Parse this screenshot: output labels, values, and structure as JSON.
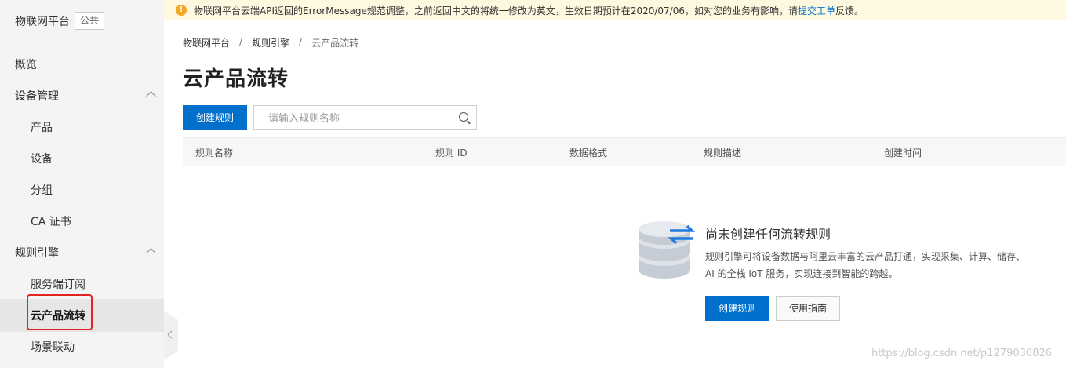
{
  "notice": {
    "text_before": "物联网平台云端API返回的ErrorMessage规范调整，之前返回中文的将统一修改为英文，生效日期预计在2020/07/06，如对您的业务有影响，请",
    "link": "提交工单",
    "text_after": "反馈。"
  },
  "sidebar": {
    "title": "物联网平台",
    "badge": "公共",
    "items": [
      {
        "label": "概览"
      },
      {
        "label": "设备管理"
      },
      {
        "label": "产品"
      },
      {
        "label": "设备"
      },
      {
        "label": "分组"
      },
      {
        "label": "CA 证书"
      },
      {
        "label": "规则引擎"
      },
      {
        "label": "服务端订阅"
      },
      {
        "label": "云产品流转"
      },
      {
        "label": "场景联动"
      }
    ]
  },
  "breadcrumb": [
    "物联网平台",
    "规则引擎",
    "云产品流转"
  ],
  "breadcrumb_sep": "/",
  "page_title": "云产品流转",
  "toolbar": {
    "create_label": "创建规则",
    "search_placeholder": "请输入规则名称"
  },
  "table": {
    "columns": [
      "规则名称",
      "规则 ID",
      "数据格式",
      "规则描述",
      "创建时间"
    ]
  },
  "empty": {
    "title": "尚未创建任何流转规则",
    "desc": "规则引擎可将设备数据与阿里云丰富的云产品打通，实现采集、计算、储存、AI 的全栈 IoT 服务，实现连接到智能的跨越。",
    "create_label": "创建规则",
    "guide_label": "使用指南"
  },
  "watermark": "https://blog.csdn.net/p1279030826",
  "colors": {
    "primary": "#0070cc",
    "highlight": "#e42323",
    "notice_bg": "#fff8e1"
  }
}
